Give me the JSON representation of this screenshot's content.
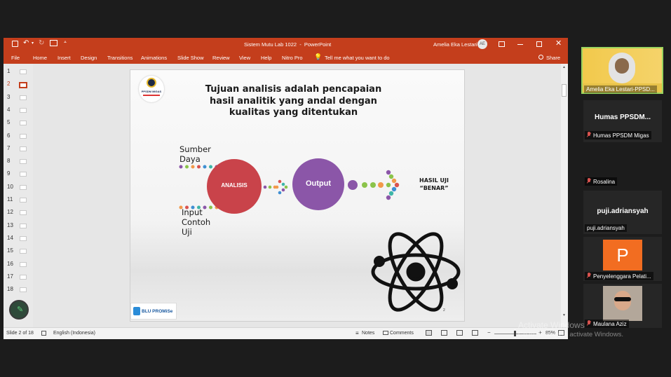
{
  "window": {
    "document_title": "Sistem Mutu Lab 1022  -  PowerPoint",
    "user_name": "Amelia Eka Lestari",
    "user_initials": "AE",
    "qat_icons": [
      "save-icon",
      "undo-icon",
      "redo-icon",
      "present-icon"
    ]
  },
  "ribbon": {
    "tabs": [
      "File",
      "Home",
      "Insert",
      "Design",
      "Transitions",
      "Animations",
      "Slide Show",
      "Review",
      "View",
      "Help",
      "Nitro Pro"
    ],
    "tell_me": "Tell me what you want to do",
    "share": "Share"
  },
  "thumbnails": [
    "1",
    "2",
    "3",
    "4",
    "5",
    "6",
    "7",
    "8",
    "9",
    "10",
    "11",
    "12",
    "13",
    "14",
    "15",
    "16",
    "17",
    "18"
  ],
  "active_slide": "2",
  "slide": {
    "logo_top_text": "PPSDM MIGAS",
    "title_lines": [
      "Tujuan analisis adalah pencapaian",
      "hasil analitik yang andal dengan",
      "kualitas yang ditentukan"
    ],
    "input1_lines": [
      "Sumber",
      "Daya"
    ],
    "input2_lines": [
      "Input",
      "Contoh",
      "Uji"
    ],
    "circle_analisis": "ANALISIS",
    "circle_output": "Output",
    "result_lines": [
      "HASIL UJI",
      "“BENAR”"
    ],
    "bottom_logo": "BLU PROMiSe",
    "slide_number": "2",
    "colors": {
      "analisis": "#c9434a",
      "output": "#8b56a8",
      "dot_green": "#8bc34a",
      "dot_orange": "#f2994a",
      "dot_blue": "#3f8fd2",
      "dot_purple": "#8b56a8",
      "dot_red": "#d9534f",
      "dot_teal": "#3fb6a8"
    }
  },
  "statusbar": {
    "slide_info": "Slide 2 of 18",
    "language": "English (Indonesia)",
    "notes": "Notes",
    "comments": "Comments",
    "zoom": "85%"
  },
  "participants": [
    {
      "name": "Amelia Eka Lestari-PPSD...",
      "muted": false
    },
    {
      "name": "Humas  PPSDM...",
      "label": "Humas PPSDM Migas",
      "muted": true
    },
    {
      "name": "Rosalina",
      "muted": true
    },
    {
      "name": "puji.adriansyah",
      "label": "puji.adriansyah",
      "muted": false
    },
    {
      "initial": "P",
      "name": "Penyelenggara Pelati...",
      "muted": true
    },
    {
      "name": "Maulana Aziz",
      "muted": true
    }
  ],
  "watermark": {
    "title": "Activate Windows",
    "subtitle": "Go to Settings to activate Windows."
  }
}
